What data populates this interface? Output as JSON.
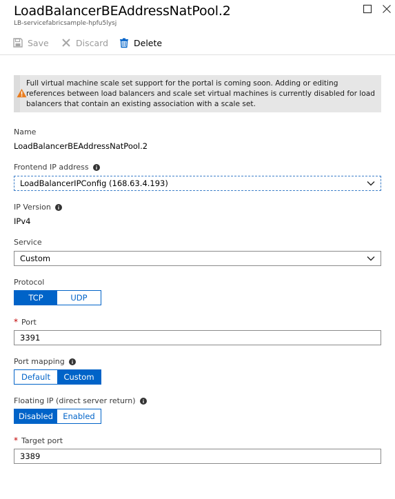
{
  "blade": {
    "title": "LoadBalancerBEAddressNatPool.2",
    "subtitle": "LB-servicefabricsample-hpfu5lysj"
  },
  "toolbar": {
    "save_label": "Save",
    "discard_label": "Discard",
    "delete_label": "Delete"
  },
  "warning": {
    "text": "Full virtual machine scale set support for the portal is coming soon. Adding or editing references between load balancers and scale set virtual machines is currently disabled for load balancers that contain an existing association with a scale set."
  },
  "fields": {
    "name": {
      "label": "Name",
      "value": "LoadBalancerBEAddressNatPool.2"
    },
    "frontend_ip": {
      "label": "Frontend IP address",
      "value": "LoadBalancerIPConfig (168.63.4.193)"
    },
    "ip_version": {
      "label": "IP Version",
      "value": "IPv4"
    },
    "service": {
      "label": "Service",
      "value": "Custom"
    },
    "protocol": {
      "label": "Protocol",
      "options": [
        "TCP",
        "UDP"
      ],
      "selected": "TCP"
    },
    "port": {
      "label": "Port",
      "required_mark": "*",
      "value": "3391"
    },
    "port_mapping": {
      "label": "Port mapping",
      "options": [
        "Default",
        "Custom"
      ],
      "selected": "Custom"
    },
    "floating_ip": {
      "label": "Floating IP (direct server return)",
      "options": [
        "Disabled",
        "Enabled"
      ],
      "selected": "Disabled"
    },
    "target_port": {
      "label": "Target port",
      "required_mark": "*",
      "value": "3389"
    }
  },
  "colors": {
    "accent": "#0063c8",
    "warning_icon": "#e87c1e",
    "required": "#c00000"
  }
}
